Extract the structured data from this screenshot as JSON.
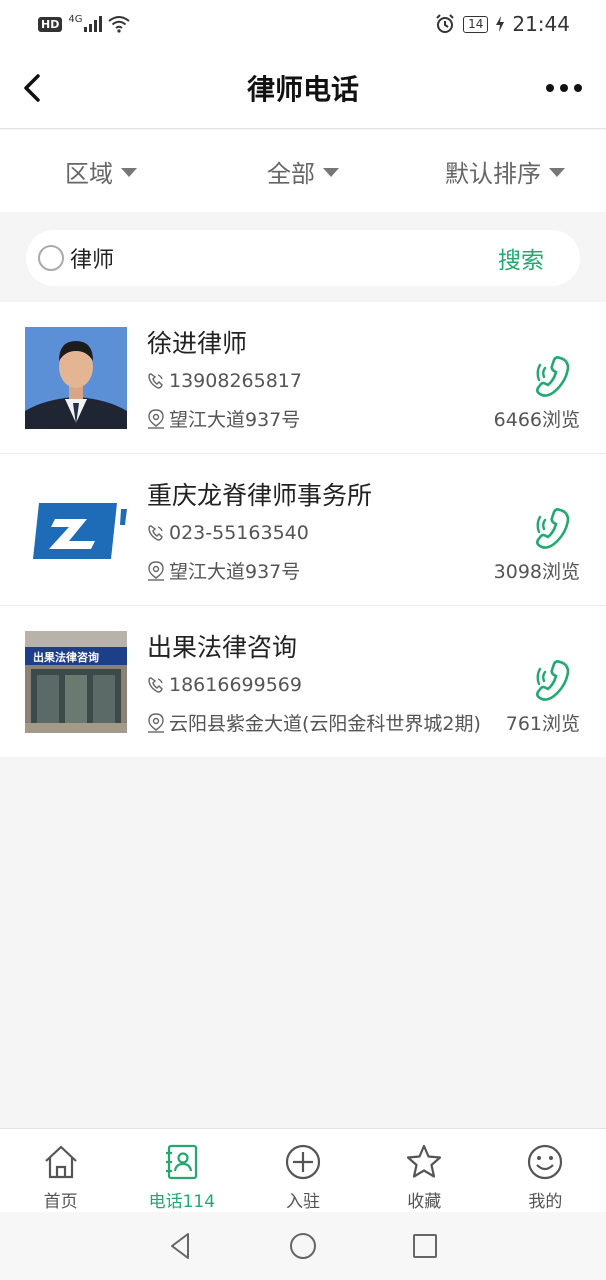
{
  "status_bar": {
    "hd": "HD",
    "network": "4G",
    "battery": "14",
    "time": "21:44"
  },
  "header": {
    "title": "律师电话"
  },
  "filters": [
    {
      "label": "区域"
    },
    {
      "label": "全部"
    },
    {
      "label": "默认排序"
    }
  ],
  "search": {
    "value": "律师",
    "button_label": "搜索"
  },
  "listings": [
    {
      "name": "徐进律师",
      "phone": "13908265817",
      "address": "望江大道937号",
      "views": "6466浏览",
      "thumb": "portrait-photo"
    },
    {
      "name": "重庆龙脊律师事务所",
      "phone": "023-55163540",
      "address": "望江大道937号",
      "views": "3098浏览",
      "thumb": "blue-logo"
    },
    {
      "name": "出果法律咨询",
      "phone": "18616699569",
      "address": "云阳县紫金大道(云阳金科世界城2期)",
      "views": "761浏览",
      "thumb": "storefront-photo",
      "sign_text": "出果法律咨询"
    }
  ],
  "bottom_nav": [
    {
      "label": "首页",
      "icon": "home-icon",
      "active": false
    },
    {
      "label": "电话114",
      "icon": "contact-card-icon",
      "active": true
    },
    {
      "label": "入驻",
      "icon": "plus-circle-icon",
      "active": false
    },
    {
      "label": "收藏",
      "icon": "star-icon",
      "active": false
    },
    {
      "label": "我的",
      "icon": "smiley-icon",
      "active": false
    }
  ],
  "colors": {
    "accent": "#23a86f",
    "background": "#f5f5f5",
    "text": "#222222"
  }
}
